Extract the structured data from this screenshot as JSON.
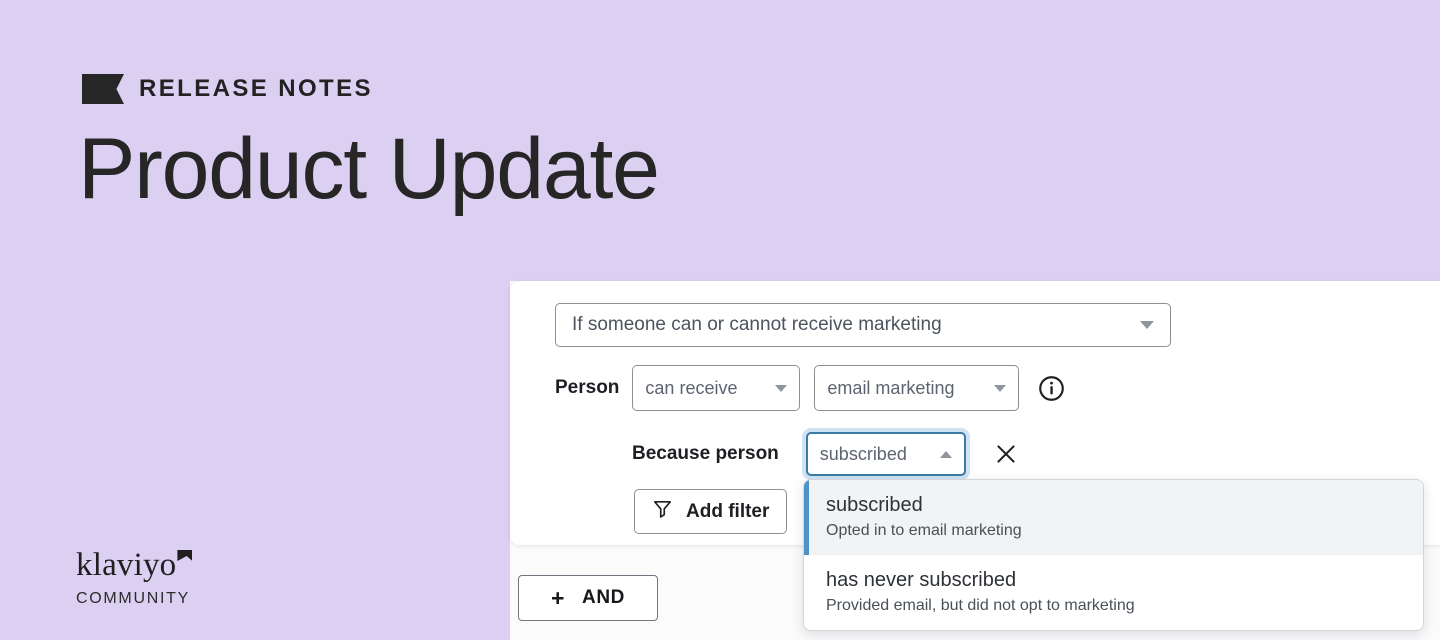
{
  "theme": {
    "backdrop_purple": "#dcd0f2",
    "ink": "#262626",
    "focus_ring": "#cfe3f5",
    "focus_border": "#3a7ba5",
    "accent_blue": "#4d93c9",
    "card_white": "#ffffff"
  },
  "banner": {
    "eyebrow": "RELEASE NOTES",
    "title": "Product Update"
  },
  "brand": {
    "name": "klaviyo",
    "sub": "COMMUNITY"
  },
  "app": {
    "condition": {
      "value": "If someone can or cannot receive marketing"
    },
    "person_row": {
      "label": "Person",
      "ability": "can receive",
      "channel": "email marketing",
      "info_icon": "info-icon"
    },
    "because_row": {
      "label": "Because person",
      "reason": "subscribed",
      "remove_icon": "close-icon"
    },
    "add_filter": {
      "label": "Add filter",
      "icon": "filter-funnel-icon"
    },
    "and_button": {
      "plus": "+",
      "label": "AND"
    },
    "dropdown": {
      "open": true,
      "items": [
        {
          "title": "subscribed",
          "desc": "Opted in to email marketing",
          "active": true
        },
        {
          "title": "has never subscribed",
          "desc": "Provided email, but did not opt to marketing",
          "active": false
        }
      ]
    }
  }
}
